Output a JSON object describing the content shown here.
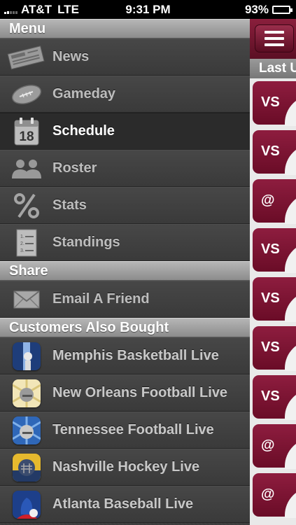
{
  "status_bar": {
    "carrier": "AT&T",
    "network": "LTE",
    "time": "9:31 PM",
    "battery_percent": "93%",
    "battery_level": 0.93
  },
  "menu": {
    "header": "Menu",
    "items": [
      {
        "label": "News",
        "icon": "newspaper-icon",
        "active": false
      },
      {
        "label": "Gameday",
        "icon": "football-icon",
        "active": false
      },
      {
        "label": "Schedule",
        "icon": "calendar-icon",
        "icon_text": "18",
        "active": true
      },
      {
        "label": "Roster",
        "icon": "people-icon",
        "active": false
      },
      {
        "label": "Stats",
        "icon": "percent-icon",
        "active": false
      },
      {
        "label": "Standings",
        "icon": "list-icon",
        "active": false
      }
    ],
    "share_header": "Share",
    "share_items": [
      {
        "label": "Email A Friend",
        "icon": "envelope-icon"
      }
    ],
    "also_bought_header": "Customers Also Bought",
    "apps": [
      {
        "label": "Memphis Basketball Live",
        "icon": "memphis-basketball-app-icon"
      },
      {
        "label": "New Orleans Football Live",
        "icon": "new-orleans-football-app-icon"
      },
      {
        "label": "Tennessee Football Live",
        "icon": "tennessee-football-app-icon"
      },
      {
        "label": "Nashville Hockey Live",
        "icon": "nashville-hockey-app-icon"
      },
      {
        "label": "Atlanta Baseball Live",
        "icon": "atlanta-baseball-app-icon"
      }
    ]
  },
  "main": {
    "menu_button_icon": "hamburger-icon",
    "list_header": "Last U",
    "games": [
      {
        "label": "VS"
      },
      {
        "label": "VS"
      },
      {
        "label": "@"
      },
      {
        "label": "VS"
      },
      {
        "label": "VS"
      },
      {
        "label": "VS"
      },
      {
        "label": "VS"
      },
      {
        "label": "@"
      },
      {
        "label": "@"
      }
    ]
  },
  "colors": {
    "brand": "#7a1330",
    "menu_bg": "#3d3d3d",
    "header_gray": "#9e9e9e"
  }
}
